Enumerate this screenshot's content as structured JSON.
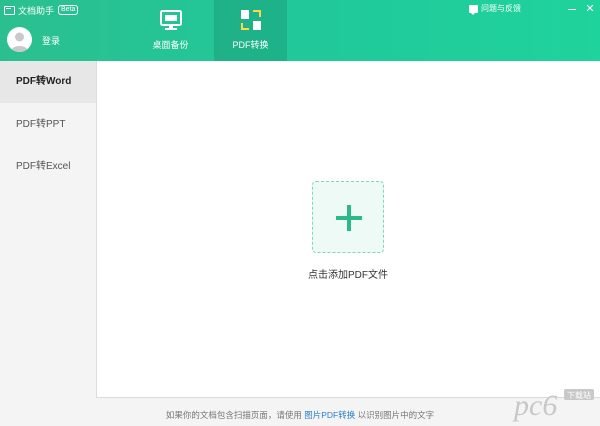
{
  "app": {
    "title": "文档助手",
    "beta": "Beta",
    "login": "登录",
    "feedback": "问题与反馈"
  },
  "nav": {
    "tabs": [
      {
        "label": "桌面备份",
        "icon": "monitor-icon"
      },
      {
        "label": "PDF转换",
        "icon": "convert-icon"
      }
    ]
  },
  "sidebar": {
    "items": [
      {
        "label": "PDF转Word"
      },
      {
        "label": "PDF转PPT"
      },
      {
        "label": "PDF转Excel"
      }
    ]
  },
  "main": {
    "drop_label": "点击添加PDF文件"
  },
  "footer": {
    "text_before": "如果你的文档包含扫描页面，请使用 ",
    "link": "图片PDF转换",
    "text_after": " 以识别图片中的文字"
  },
  "watermark": {
    "text": "pc6",
    "subtext": "下载站"
  },
  "colors": {
    "header_green": "#21c89a",
    "accent_green": "#2bb987",
    "link_blue": "#2a7ec8"
  }
}
